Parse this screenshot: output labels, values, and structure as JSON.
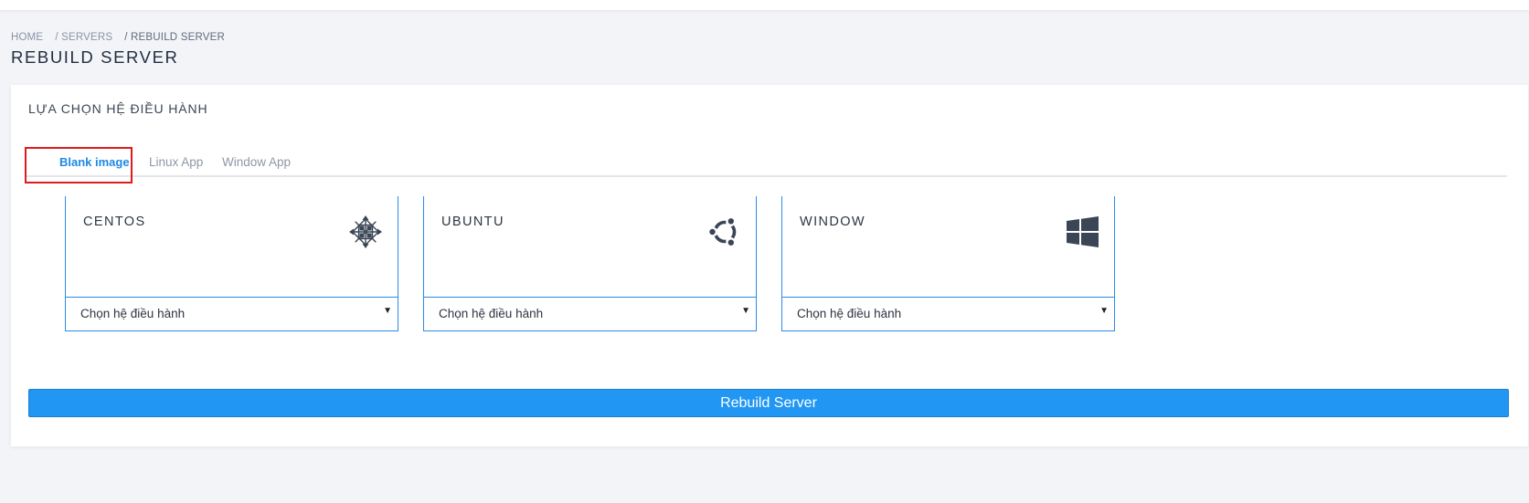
{
  "breadcrumb": {
    "home": "HOME",
    "servers": "/ SERVERS",
    "current": "/ REBUILD SERVER"
  },
  "page_title": "REBUILD SERVER",
  "card": {
    "title": "LỰA CHỌN HỆ ĐIỀU HÀNH"
  },
  "tabs": [
    {
      "label": "Blank image",
      "active": true
    },
    {
      "label": "Linux App",
      "active": false
    },
    {
      "label": "Window App",
      "active": false
    }
  ],
  "os_options": [
    {
      "name": "CENTOS",
      "icon": "centos-icon",
      "select_value": "Chọn hệ điều hành"
    },
    {
      "name": "UBUNTU",
      "icon": "ubuntu-icon",
      "select_value": "Chọn hệ điều hành"
    },
    {
      "name": "WINDOW",
      "icon": "windows-icon",
      "select_value": "Chọn hệ điều hành"
    }
  ],
  "rebuild_button": "Rebuild Server",
  "colors": {
    "accent": "#2196f3",
    "highlight": "#e01b1b",
    "icon": "#3a4556"
  }
}
